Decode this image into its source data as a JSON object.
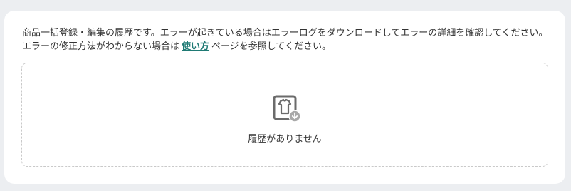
{
  "description": {
    "text_before_link": "商品一括登録・編集の履歴です。エラーが起きている場合はエラーログをダウンロードしてエラーの詳細を確認してください。エラーの修正方法がわからない場合は",
    "link_label": "使い方",
    "text_after_link": "ページを参照してください。"
  },
  "empty_state": {
    "icon": "clothing-download-icon",
    "message": "履歴がありません"
  },
  "colors": {
    "link": "#1f7a74",
    "icon": "#6b6b6b",
    "badge": "#a9a9a9"
  }
}
